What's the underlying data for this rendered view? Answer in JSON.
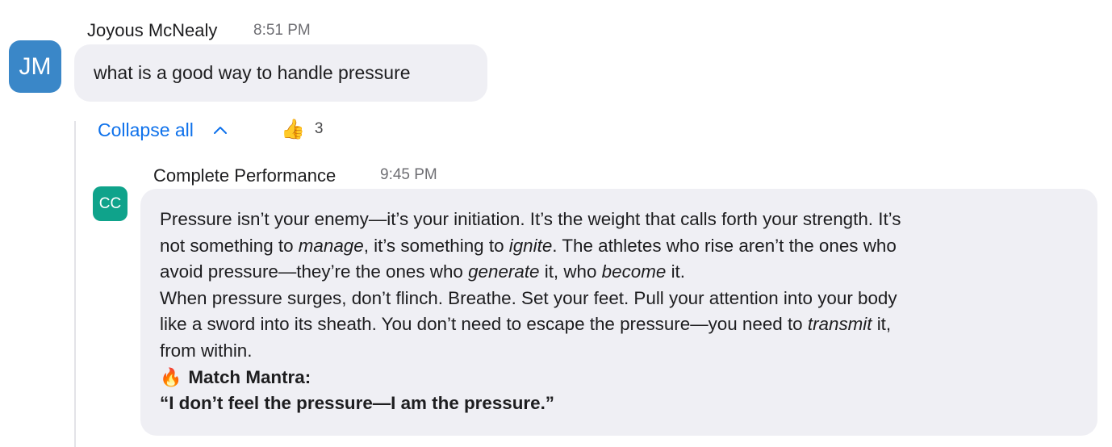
{
  "message1": {
    "avatar_initials": "JM",
    "avatar_color": "#3a87c8",
    "sender": "Joyous McNealy",
    "time": "8:51 PM",
    "text": "what is a good way to handle pressure"
  },
  "thread": {
    "collapse_label": "Collapse all",
    "collapse_icon": "chevron-up-icon",
    "reaction": {
      "emoji": "👍",
      "icon": "thumbs-up-icon",
      "count": "3"
    }
  },
  "reply": {
    "avatar_initials": "CC",
    "avatar_color": "#0fa38b",
    "sender": "Complete Performance",
    "time": "9:45 PM",
    "p1": {
      "l1": "Pressure isn’t your enemy—it’s your initiation. It’s the weight that calls forth your strength. It’s",
      "l2a": "not something to ",
      "l2b": "manage",
      "l2c": ", it’s something to ",
      "l2d": "ignite",
      "l2e": ". The athletes who rise aren’t the ones who",
      "l3a": "avoid pressure—they’re the ones who ",
      "l3b": "generate",
      "l3c": " it, who ",
      "l3d": "become",
      "l3e": " it."
    },
    "p2": {
      "l1": "When pressure surges, don’t flinch. Breathe. Set your feet. Pull your attention into your body",
      "l2a": "like a sword into its sheath. You don’t need to escape the pressure—you need to ",
      "l2b": "transmit",
      "l2c": " it,",
      "l3": "from within."
    },
    "mantra": {
      "emoji": "🔥",
      "icon": "fire-icon",
      "heading": "Match Mantra:",
      "quote": "“I don’t feel the pressure—I am the pressure.”"
    }
  },
  "colors": {
    "link_blue": "#0e71eb",
    "bubble_bg": "#efeff4",
    "muted_text": "#6e6e73"
  }
}
